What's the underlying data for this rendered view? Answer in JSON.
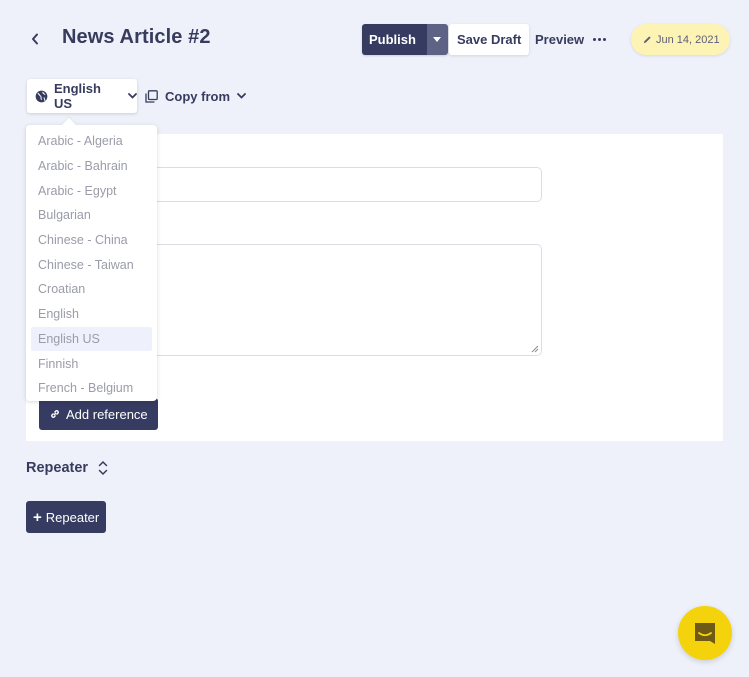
{
  "header": {
    "title": "News Article #2",
    "publish_label": "Publish",
    "save_draft_label": "Save Draft",
    "preview_label": "Preview",
    "date_badge": "Jun 14, 2021"
  },
  "toolbar": {
    "language_selected": "English US",
    "copy_from_label": "Copy from"
  },
  "language_dropdown": {
    "options": [
      "Arabic - Algeria",
      "Arabic - Bahrain",
      "Arabic - Egypt",
      "Bulgarian",
      "Chinese - China",
      "Chinese - Taiwan",
      "Croatian",
      "English",
      "English US",
      "Finnish",
      "French - Belgium"
    ],
    "selected": "English US"
  },
  "form": {
    "title_value": "",
    "body_value": "",
    "add_reference_label": "Add reference"
  },
  "repeater": {
    "label": "Repeater",
    "add_label": "Repeater"
  },
  "colors": {
    "primary": "#363b62",
    "background": "#eef1f9",
    "badge": "#fdf3b5",
    "chat": "#f5d30c"
  }
}
